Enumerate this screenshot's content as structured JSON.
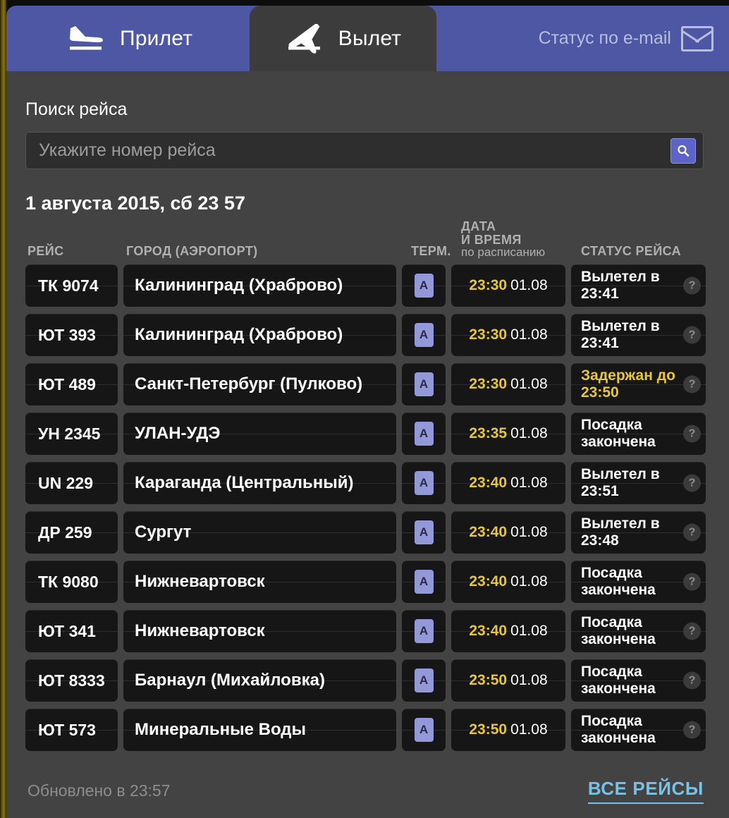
{
  "header": {
    "tabs": [
      {
        "id": "arrival",
        "label": "Прилет",
        "icon": "plane-arrival-icon",
        "active": false
      },
      {
        "id": "departure",
        "label": "Вылет",
        "icon": "plane-departure-icon",
        "active": true
      }
    ],
    "email_status": {
      "label": "Статус по e-mail",
      "icon": "envelope-icon"
    },
    "accent_color": "#4d57a4"
  },
  "search": {
    "title": "Поиск рейса",
    "placeholder": "Укажите номер рейса",
    "value": "",
    "button_icon": "search-icon",
    "button_color": "#5c63c9"
  },
  "board": {
    "date_line": "1 августа 2015, сб 23 57",
    "columns": {
      "flight": "РЕЙС",
      "city": "ГОРОД (АЭРОПОРТ)",
      "terminal": "ТЕРМ.",
      "datetime_top": "ДАТА",
      "datetime_mid": "И ВРЕМЯ",
      "datetime_sub": "по расписанию",
      "status": "СТАТУС РЕЙСА"
    },
    "rows": [
      {
        "flight": "ТК 9074",
        "city": "Калининград (Храброво)",
        "terminal": "A",
        "time": "23:30",
        "date": "01.08",
        "status": "Вылетел в 23:41",
        "delayed": false
      },
      {
        "flight": "ЮТ 393",
        "city": "Калининград (Храброво)",
        "terminal": "A",
        "time": "23:30",
        "date": "01.08",
        "status": "Вылетел в 23:41",
        "delayed": false
      },
      {
        "flight": "ЮТ 489",
        "city": "Санкт-Петербург (Пулково)",
        "terminal": "A",
        "time": "23:30",
        "date": "01.08",
        "status": "Задержан до 23:50",
        "delayed": true
      },
      {
        "flight": "УН 2345",
        "city": "УЛАН-УДЭ",
        "terminal": "A",
        "time": "23:35",
        "date": "01.08",
        "status": "Посадка закончена",
        "delayed": false
      },
      {
        "flight": "UN 229",
        "city": "Караганда (Центральный)",
        "terminal": "A",
        "time": "23:40",
        "date": "01.08",
        "status": "Вылетел в 23:51",
        "delayed": false
      },
      {
        "flight": "ДР 259",
        "city": "Сургут",
        "terminal": "A",
        "time": "23:40",
        "date": "01.08",
        "status": "Вылетел в 23:48",
        "delayed": false
      },
      {
        "flight": "ТК 9080",
        "city": "Нижневартовск",
        "terminal": "A",
        "time": "23:40",
        "date": "01.08",
        "status": "Посадка закончена",
        "delayed": false
      },
      {
        "flight": "ЮТ 341",
        "city": "Нижневартовск",
        "terminal": "A",
        "time": "23:40",
        "date": "01.08",
        "status": "Посадка закончена",
        "delayed": false
      },
      {
        "flight": "ЮТ 8333",
        "city": "Барнаул (Михайловка)",
        "terminal": "A",
        "time": "23:50",
        "date": "01.08",
        "status": "Посадка закончена",
        "delayed": false
      },
      {
        "flight": "ЮТ 573",
        "city": "Минеральные Воды",
        "terminal": "A",
        "time": "23:50",
        "date": "01.08",
        "status": "Посадка закончена",
        "delayed": false
      }
    ],
    "help_glyph": "?",
    "status_delayed_color": "#e8c832",
    "time_color": "#e8c832"
  },
  "footer": {
    "updated": "Обновлено в 23:57",
    "all_flights": "ВСЕ РЕЙСЫ",
    "link_color": "#78c2e8"
  }
}
